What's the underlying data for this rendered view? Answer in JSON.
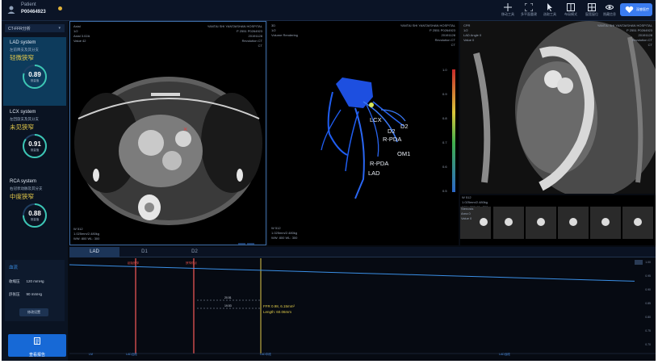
{
  "topbar": {
    "patient_name": "Patient",
    "patient_id": "P00464923",
    "tools": [
      {
        "icon": "crosshair-icon",
        "label": "移动工具"
      },
      {
        "icon": "focus-icon",
        "label": "多平面重建"
      },
      {
        "icon": "pointer-icon",
        "label": "选取工具"
      },
      {
        "icon": "layout-icon",
        "label": "布局模式"
      },
      {
        "icon": "window-icon",
        "label": "窗宽窗位"
      },
      {
        "icon": "eye-icon",
        "label": "隐藏信息"
      }
    ],
    "logo_text": "深睿医疗"
  },
  "sidebar": {
    "tab_label": "CT-FFR分析",
    "systems": [
      {
        "name": "LAD system",
        "subtitle": "左前降支及其分支",
        "status": "轻微狭窄",
        "status_color": "#e3c94a",
        "ffr": "0.89",
        "ffr_label": "测量值",
        "active": true
      },
      {
        "name": "LCX system",
        "subtitle": "左回旋支及其分支",
        "status": "未见狭窄",
        "status_color": "#e3c94a",
        "ffr": "0.91",
        "ffr_label": "测量值",
        "active": false
      },
      {
        "name": "RCA system",
        "subtitle": "右冠状动脉及其分支",
        "status": "中度狭窄",
        "status_color": "#e3c94a",
        "ffr": "0.88",
        "ffr_label": "测量值",
        "active": false
      }
    ],
    "blood_pressure": {
      "title": "血流",
      "systolic_label": "收缩压",
      "systolic_value": "120 mmHg",
      "diastolic_label": "舒张压",
      "diastolic_value": "90 mmHg",
      "button_label": "修改设置"
    },
    "report_button": "查看报告"
  },
  "viewports": {
    "axial": {
      "top_left": [
        "Axial",
        "1/2",
        "Axial 3.02A",
        "Value 42"
      ],
      "top_right": [
        "YANTAI SHI YANTAISHAN HOSPITAL",
        "P 2551 P0264923",
        "20191128",
        "Revolution CT",
        "CT"
      ],
      "bottom_left": [
        "W 512",
        "1.025mm/2.480kg",
        "WW: 800  WL: 300"
      ],
      "marker": "×"
    },
    "vr": {
      "top_left": [
        "3D",
        "1/2",
        "Volume Rendering"
      ],
      "top_right": [
        "YANTAI SHI YANTAISHAN HOSPITAL",
        "P 2551 P0264923",
        "20191128",
        "Revolution CT",
        "CT"
      ],
      "bottom_left": [
        "W 512",
        "1.025mm/2.480kg",
        "WW: 800  WL: 300"
      ],
      "labels": [
        "LCX",
        "D2",
        "D2",
        "R-PDA",
        "OM1",
        "R-PDA",
        "LAD"
      ],
      "colorbar_ticks": [
        "1.0",
        "0.9",
        "0.8",
        "0.7",
        "0.6",
        "0.5"
      ]
    },
    "curved": {
      "top_left": [
        "CPR",
        "1/2",
        "LAD Angle 0",
        "Value 0"
      ],
      "top_right": [
        "YANTAI SHI YANTAISHAN HOSPITAL",
        "P 2551 P0264923",
        "20191128",
        "Revolution CT",
        "CT"
      ]
    },
    "cross": {
      "top_left": [
        "W 512",
        "1.025mm/2.480kg",
        "WW: 800  WL: 300"
      ],
      "thumb_text": [
        "Stenosis",
        "Area 0",
        "Value 0"
      ]
    }
  },
  "plot": {
    "tabs": [
      "LAD",
      "D1",
      "D2"
    ],
    "active_tab": "LAD",
    "lesion_labels": [
      "起始狭窄",
      "狭窄终点"
    ],
    "measure_lines": [
      "FFR 0.98, 6.15mm²",
      "Length: 60.06mm"
    ],
    "dim_labels": [
      "20.51",
      "19.53"
    ],
    "x_labels": [
      "LM",
      "LAD近段",
      "LAD中段",
      "LAD远段"
    ],
    "y_ticks": [
      "1.00",
      "0.95",
      "0.90",
      "0.85",
      "0.80",
      "0.75",
      "0.70"
    ],
    "ffr_curve": [
      1.0,
      0.995,
      0.99,
      0.985,
      0.98,
      0.975,
      0.97,
      0.965,
      0.96,
      0.955,
      0.95,
      0.945,
      0.94
    ]
  }
}
